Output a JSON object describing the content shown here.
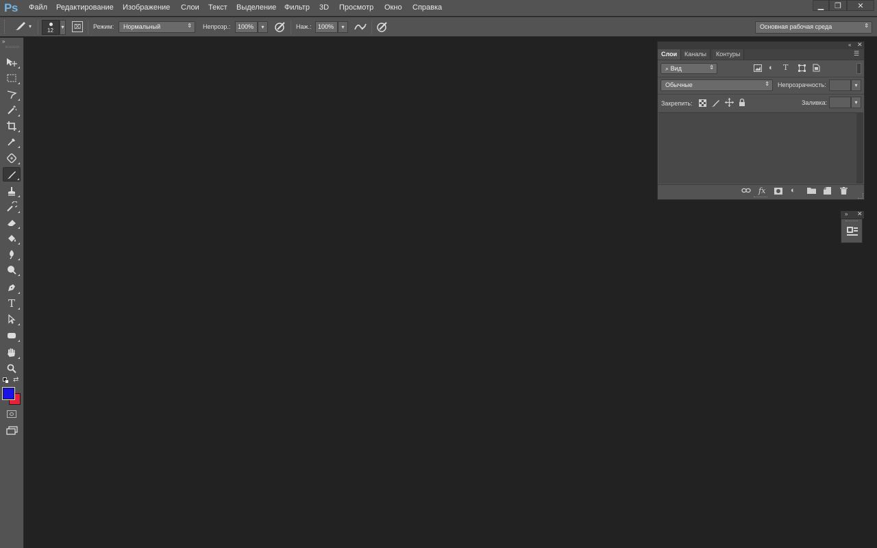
{
  "app": {
    "logo": "Ps"
  },
  "menu": [
    "Файл",
    "Редактирование",
    "Изображение",
    "Слои",
    "Текст",
    "Выделение",
    "Фильтр",
    "3D",
    "Просмотр",
    "Окно",
    "Справка"
  ],
  "window_controls": {
    "minimize": "▁",
    "restore": "❐",
    "close": "✕"
  },
  "options_bar": {
    "brush_size": "12",
    "mode_label": "Режим:",
    "mode_value": "Нормальный",
    "opacity_label": "Непрозр.:",
    "opacity_value": "100%",
    "flow_label": "Наж.:",
    "flow_value": "100%",
    "workspace_value": "Основная рабочая среда"
  },
  "layers_panel": {
    "tabs": [
      "Слои",
      "Каналы",
      "Контуры"
    ],
    "active_tab": "Слои",
    "filter_kind": "Вид",
    "blend_mode": "Обычные",
    "opacity_label": "Непрозрачность:",
    "lock_label": "Закрепить:",
    "fill_label": "Заливка:"
  },
  "colors": {
    "foreground": "#1a12e6",
    "background": "#e8203a",
    "canvas": "#222222",
    "chrome": "#535353"
  },
  "tools": [
    "move-tool",
    "marquee-tool",
    "lasso-tool",
    "magic-wand-tool",
    "crop-tool",
    "eyedropper-tool",
    "healing-brush-tool",
    "brush-tool",
    "clone-stamp-tool",
    "history-brush-tool",
    "eraser-tool",
    "paint-bucket-tool",
    "blur-tool",
    "dodge-tool",
    "pen-tool",
    "type-tool",
    "path-selection-tool",
    "shape-tool",
    "hand-tool",
    "zoom-tool"
  ]
}
